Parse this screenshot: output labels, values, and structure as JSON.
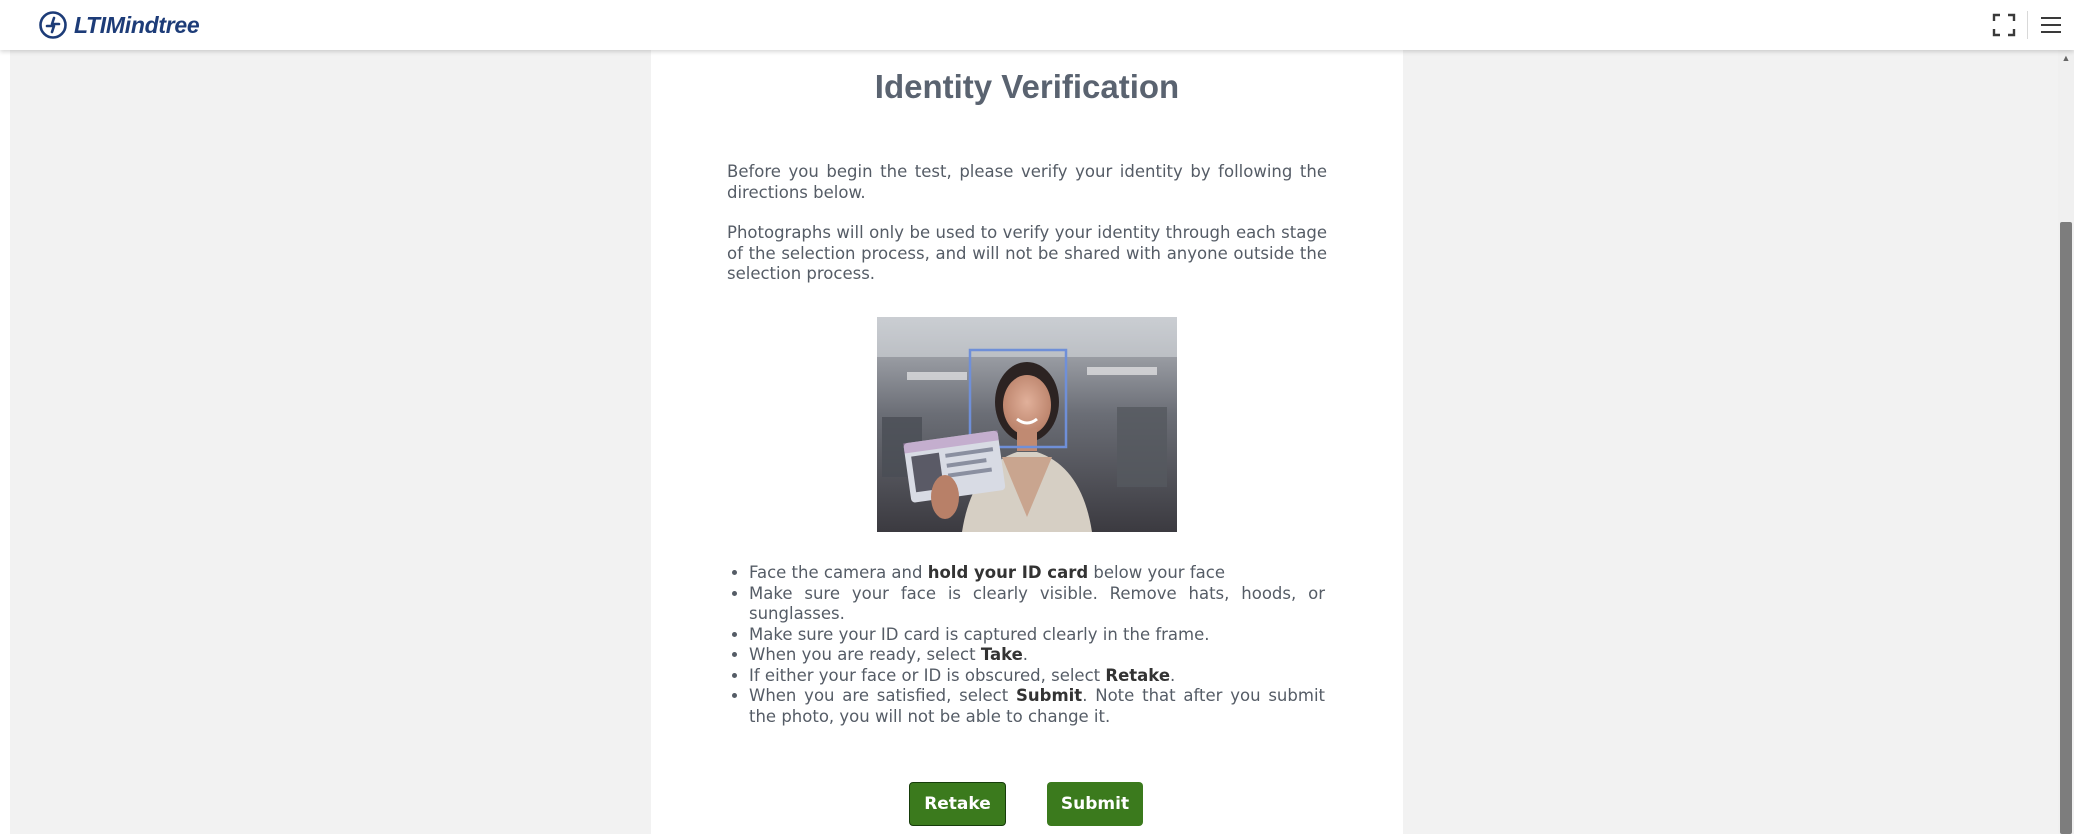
{
  "header": {
    "brand": "LTIMindtree",
    "fullscreen_icon": "fullscreen-icon",
    "menu_icon": "hamburger-menu-icon"
  },
  "page": {
    "title": "Identity Verification",
    "intro": "Before you begin the test, please verify your identity by following the directions below.",
    "privacy": "Photographs will only be used to verify your identity through each stage of the selection process, and will not be shared with anyone outside the selection process."
  },
  "instructions": [
    {
      "pre": "Face the camera and ",
      "bold": "hold your ID card",
      "post": " below your face"
    },
    {
      "pre": "Make sure your face is clearly visible. Remove hats, hoods, or sunglasses.",
      "bold": "",
      "post": ""
    },
    {
      "pre": "Make sure your ID card is captured clearly in the frame.",
      "bold": "",
      "post": ""
    },
    {
      "pre": "When you are ready, select ",
      "bold": "Take",
      "post": "."
    },
    {
      "pre": "If either your face or ID is obscured, select ",
      "bold": "Retake",
      "post": "."
    },
    {
      "pre": "When you are satisfied, select ",
      "bold": "Submit",
      "post": ". Note that after you submit the photo, you will not be able to change it."
    }
  ],
  "actions": {
    "retake_label": "Retake",
    "submit_label": "Submit"
  },
  "colors": {
    "button_green": "#3b7a1d",
    "brand_blue": "#1d3c78",
    "face_box": "#6f8fd8"
  }
}
